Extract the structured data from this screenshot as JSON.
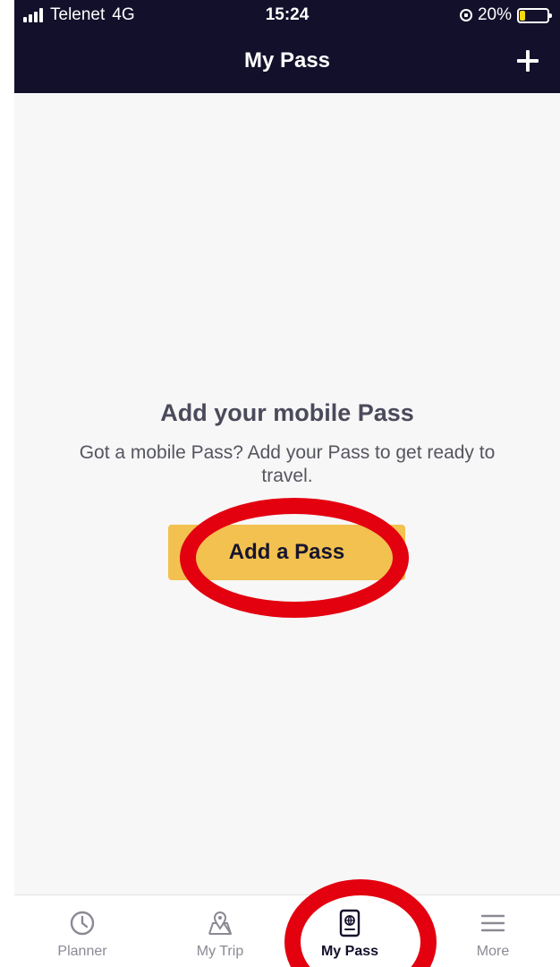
{
  "status_bar": {
    "carrier": "Telenet",
    "network": "4G",
    "time": "15:24",
    "battery_percent": "20%",
    "battery_level": 0.2
  },
  "header": {
    "title": "My Pass",
    "add_icon": "plus-icon"
  },
  "empty_state": {
    "title": "Add your mobile Pass",
    "description": "Got a mobile Pass? Add your Pass to get ready to travel.",
    "button_label": "Add a Pass"
  },
  "tabs": [
    {
      "label": "Planner",
      "icon": "clock-icon",
      "active": false
    },
    {
      "label": "My Trip",
      "icon": "map-pin-icon",
      "active": false
    },
    {
      "label": "My Pass",
      "icon": "passport-icon",
      "active": true
    },
    {
      "label": "More",
      "icon": "menu-icon",
      "active": false
    }
  ],
  "colors": {
    "header_bg": "#13102b",
    "accent": "#f2c14f",
    "annotation": "#e3000f",
    "page_bg": "#f7f7f7"
  }
}
